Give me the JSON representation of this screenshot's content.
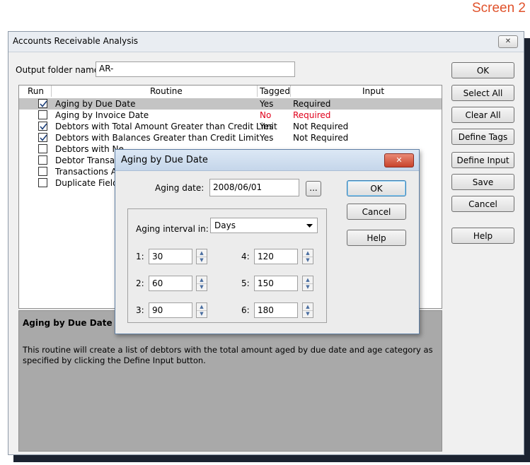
{
  "screen_label": "Screen 2",
  "window": {
    "title": "Accounts Receivable Analysis",
    "close_label": "✕",
    "output_folder_label": "Output folder name:",
    "output_folder_value": "AR-"
  },
  "list": {
    "headers": {
      "run": "Run",
      "routine": "Routine",
      "tagged": "Tagged",
      "input": "Input"
    },
    "rows": [
      {
        "checked": true,
        "routine": "Aging by Due Date",
        "tagged": "Yes",
        "input": "Required",
        "selected": true
      },
      {
        "checked": false,
        "routine": "Aging by Invoice Date",
        "tagged": "No",
        "input": "Required",
        "red": true
      },
      {
        "checked": true,
        "routine": "Debtors with Total Amount Greater than Credit Limit",
        "tagged": "Yes",
        "input": "Not Required"
      },
      {
        "checked": true,
        "routine": "Debtors with Balances Greater than Credit Limit",
        "tagged": "Yes",
        "input": "Not Required"
      },
      {
        "checked": false,
        "routine": "Debtors with Ne",
        "tagged": "",
        "input": ""
      },
      {
        "checked": false,
        "routine": "Debtor Transact",
        "tagged": "",
        "input": ""
      },
      {
        "checked": false,
        "routine": "Transactions Ar",
        "tagged": "",
        "input": ""
      },
      {
        "checked": false,
        "routine": "Duplicate Field S",
        "tagged": "",
        "input": ""
      }
    ]
  },
  "description": {
    "title": "Aging by Due Date",
    "text": "This routine will create a list of debtors with the total amount aged by due date and age category as specified by clicking the Define Input button."
  },
  "side_buttons": {
    "ok": "OK",
    "select_all": "Select All",
    "clear_all": "Clear All",
    "define_tags": "Define Tags",
    "define_input": "Define Input",
    "save": "Save",
    "cancel": "Cancel",
    "help": "Help"
  },
  "dialog": {
    "title": "Aging by Due Date",
    "close_label": "✕",
    "aging_date_label": "Aging date:",
    "aging_date_value": "2008/06/01",
    "browse_label": "...",
    "interval_label": "Aging interval in:",
    "interval_value": "Days",
    "ok": "OK",
    "cancel": "Cancel",
    "help": "Help",
    "intervals": [
      {
        "label": "1:",
        "value": "30"
      },
      {
        "label": "2:",
        "value": "60"
      },
      {
        "label": "3:",
        "value": "90"
      },
      {
        "label": "4:",
        "value": "120"
      },
      {
        "label": "5:",
        "value": "150"
      },
      {
        "label": "6:",
        "value": "180"
      }
    ]
  }
}
